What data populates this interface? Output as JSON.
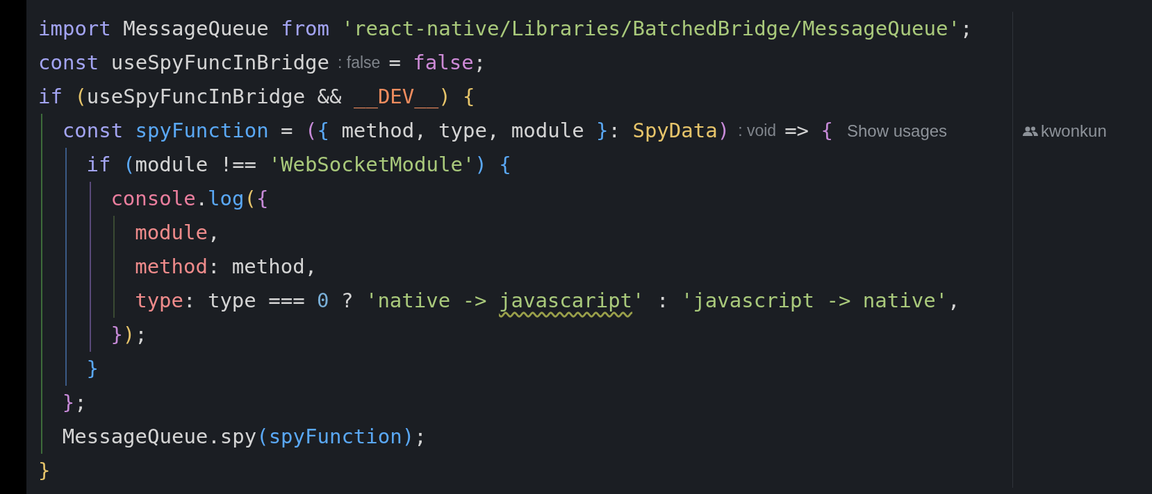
{
  "lines": [
    {
      "segments": [
        {
          "kind": "code",
          "tokens": [
            {
              "kind": "keyword",
              "text": "import"
            },
            {
              "kind": "plain",
              "text": " MessageQueue "
            },
            {
              "kind": "keyword",
              "text": "from "
            },
            {
              "kind": "string",
              "text": "'react-native/Libraries/BatchedBridge/MessageQueue'"
            },
            {
              "kind": "plain",
              "text": ";"
            }
          ]
        }
      ]
    },
    {
      "segments": [
        {
          "kind": "code",
          "tokens": [
            {
              "kind": "keyword",
              "text": "const"
            },
            {
              "kind": "plain",
              "text": " useSpyFuncInBridge"
            }
          ]
        },
        {
          "kind": "hint",
          "text": ": false"
        },
        {
          "kind": "code",
          "tokens": [
            {
              "kind": "plain",
              "text": "= "
            },
            {
              "kind": "boolean",
              "text": "false"
            },
            {
              "kind": "plain",
              "text": ";"
            }
          ]
        }
      ]
    },
    {
      "segments": [
        {
          "kind": "code",
          "tokens": [
            {
              "kind": "keyword",
              "text": "if "
            },
            {
              "kind": "bracket1",
              "text": "("
            },
            {
              "kind": "plain",
              "text": "useSpyFuncInBridge && "
            },
            {
              "kind": "constant",
              "text": "__DEV__"
            },
            {
              "kind": "bracket1",
              "text": ")"
            },
            {
              "kind": "bracket1",
              "text": " {"
            }
          ]
        }
      ],
      "children": [
        {
          "segments": [
            {
              "kind": "code",
              "tokens": [
                {
                  "kind": "keyword",
                  "text": "const "
                },
                {
                  "kind": "function",
                  "text": "spyFunction"
                },
                {
                  "kind": "plain",
                  "text": " = "
                },
                {
                  "kind": "bracket2",
                  "text": "("
                },
                {
                  "kind": "bracket3",
                  "text": "{"
                },
                {
                  "kind": "plain",
                  "text": " method, type, module "
                },
                {
                  "kind": "bracket3",
                  "text": "}"
                },
                {
                  "kind": "plain",
                  "text": ": "
                },
                {
                  "kind": "type",
                  "text": "SpyData"
                },
                {
                  "kind": "bracket2",
                  "text": ")"
                }
              ]
            },
            {
              "kind": "hint",
              "text": ": void"
            },
            {
              "kind": "code",
              "tokens": [
                {
                  "kind": "plain",
                  "text": "=> "
                },
                {
                  "kind": "bracket2",
                  "text": "{"
                }
              ]
            },
            {
              "kind": "usages",
              "text": "Show usages"
            },
            {
              "kind": "author",
              "text": "kwonkun"
            }
          ],
          "children": [
            {
              "segments": [
                {
                  "kind": "code",
                  "tokens": [
                    {
                      "kind": "keyword",
                      "text": "if "
                    },
                    {
                      "kind": "bracket3",
                      "text": "("
                    },
                    {
                      "kind": "plain",
                      "text": "module !== "
                    },
                    {
                      "kind": "string",
                      "text": "'WebSocketModule'"
                    },
                    {
                      "kind": "bracket3",
                      "text": ")"
                    },
                    {
                      "kind": "bracket3",
                      "text": " {"
                    }
                  ]
                }
              ],
              "children": [
                {
                  "segments": [
                    {
                      "kind": "code",
                      "tokens": [
                        {
                          "kind": "object",
                          "text": "console"
                        },
                        {
                          "kind": "plain",
                          "text": "."
                        },
                        {
                          "kind": "function",
                          "text": "log"
                        },
                        {
                          "kind": "bracket1",
                          "text": "("
                        },
                        {
                          "kind": "bracket2",
                          "text": "{"
                        }
                      ]
                    }
                  ],
                  "children": [
                    {
                      "segments": [
                        {
                          "kind": "code",
                          "tokens": [
                            {
                              "kind": "property",
                              "text": "module"
                            },
                            {
                              "kind": "plain",
                              "text": ","
                            }
                          ]
                        }
                      ]
                    },
                    {
                      "segments": [
                        {
                          "kind": "code",
                          "tokens": [
                            {
                              "kind": "property",
                              "text": "method"
                            },
                            {
                              "kind": "plain",
                              "text": ": method,"
                            }
                          ]
                        }
                      ]
                    },
                    {
                      "segments": [
                        {
                          "kind": "code",
                          "tokens": [
                            {
                              "kind": "property",
                              "text": "type"
                            },
                            {
                              "kind": "plain",
                              "text": ": type === "
                            },
                            {
                              "kind": "number",
                              "text": "0"
                            },
                            {
                              "kind": "plain",
                              "text": " ? "
                            },
                            {
                              "kind": "string",
                              "text": "'native -> "
                            },
                            {
                              "kind": "string",
                              "text": "javascaript",
                              "typo": true
                            },
                            {
                              "kind": "string",
                              "text": "'"
                            },
                            {
                              "kind": "plain",
                              "text": " : "
                            },
                            {
                              "kind": "string",
                              "text": "'javascript -> native'"
                            },
                            {
                              "kind": "plain",
                              "text": ","
                            }
                          ]
                        }
                      ]
                    }
                  ],
                  "close": [
                    {
                      "kind": "bracket2",
                      "text": "}"
                    },
                    {
                      "kind": "bracket1",
                      "text": ")"
                    },
                    {
                      "kind": "plain",
                      "text": ";"
                    }
                  ]
                }
              ],
              "close": [
                {
                  "kind": "bracket3",
                  "text": "}"
                }
              ]
            }
          ],
          "close": [
            {
              "kind": "bracket2",
              "text": "}"
            },
            {
              "kind": "plain",
              "text": ";"
            }
          ]
        },
        {
          "segments": [
            {
              "kind": "code",
              "tokens": [
                {
                  "kind": "plain",
                  "text": "MessageQueue.spy"
                },
                {
                  "kind": "bracket3",
                  "text": "("
                },
                {
                  "kind": "function",
                  "text": "spyFunction"
                },
                {
                  "kind": "bracket3",
                  "text": ")"
                },
                {
                  "kind": "plain",
                  "text": ";"
                }
              ]
            }
          ]
        }
      ],
      "close": [
        {
          "kind": "bracket1",
          "text": "}"
        }
      ]
    }
  ]
}
